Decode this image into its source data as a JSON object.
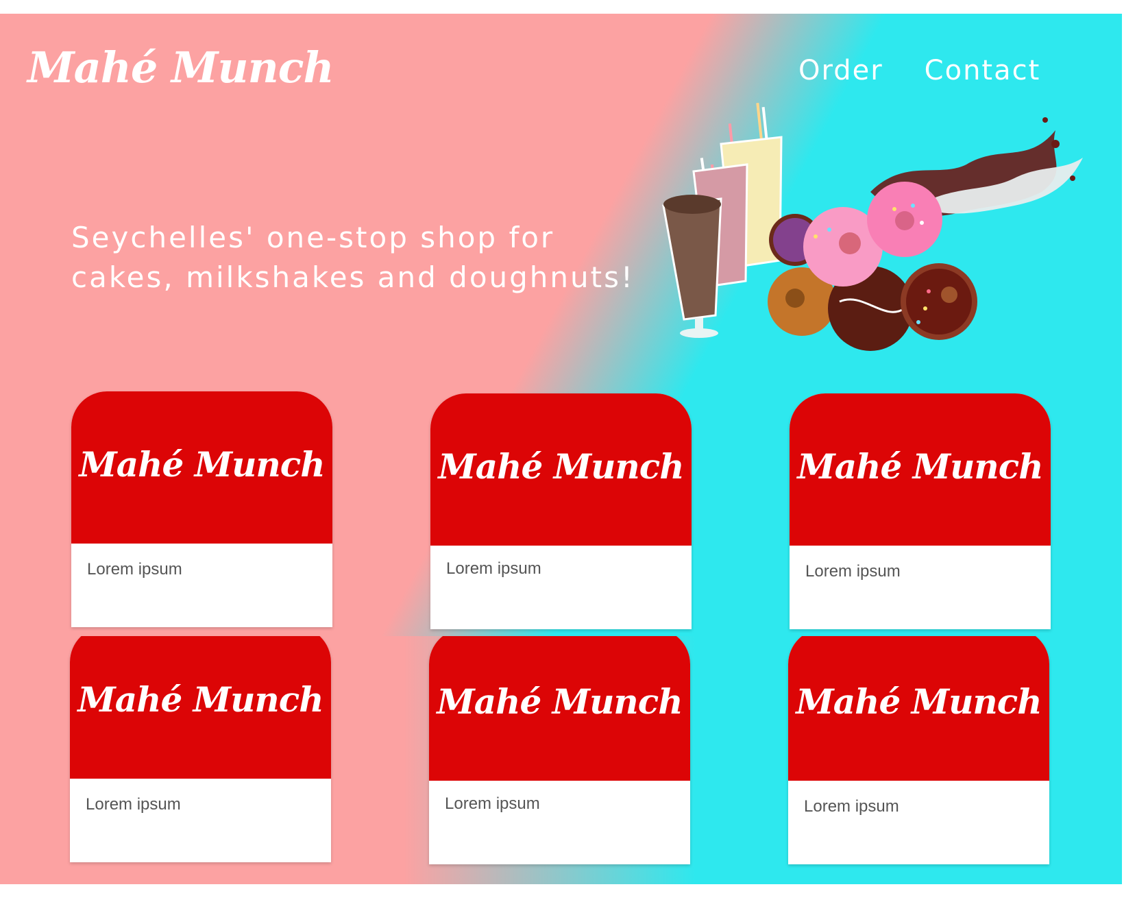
{
  "header": {
    "logo": "Mahé Munch",
    "nav": [
      {
        "label": "Order"
      },
      {
        "label": "Contact"
      }
    ]
  },
  "hero": {
    "tagline_line1": "Seychelles' one-stop shop for",
    "tagline_line2": "cakes, milkshakes and doughnuts!",
    "image": "milkshakes-and-doughnuts-illustration"
  },
  "cards": [
    {
      "logo": "Mahé Munch",
      "text": "Lorem ipsum"
    },
    {
      "logo": "Mahé Munch",
      "text": "Lorem ipsum"
    },
    {
      "logo": "Mahé Munch",
      "text": "Lorem ipsum"
    },
    {
      "logo": "Mahé Munch",
      "text": "Lorem ipsum"
    },
    {
      "logo": "Mahé Munch",
      "text": "Lorem ipsum"
    },
    {
      "logo": "Mahé Munch",
      "text": "Lorem ipsum"
    }
  ],
  "colors": {
    "pink": "#fca2a2",
    "cyan": "#2ee8ee",
    "card_red": "#dc0506"
  }
}
